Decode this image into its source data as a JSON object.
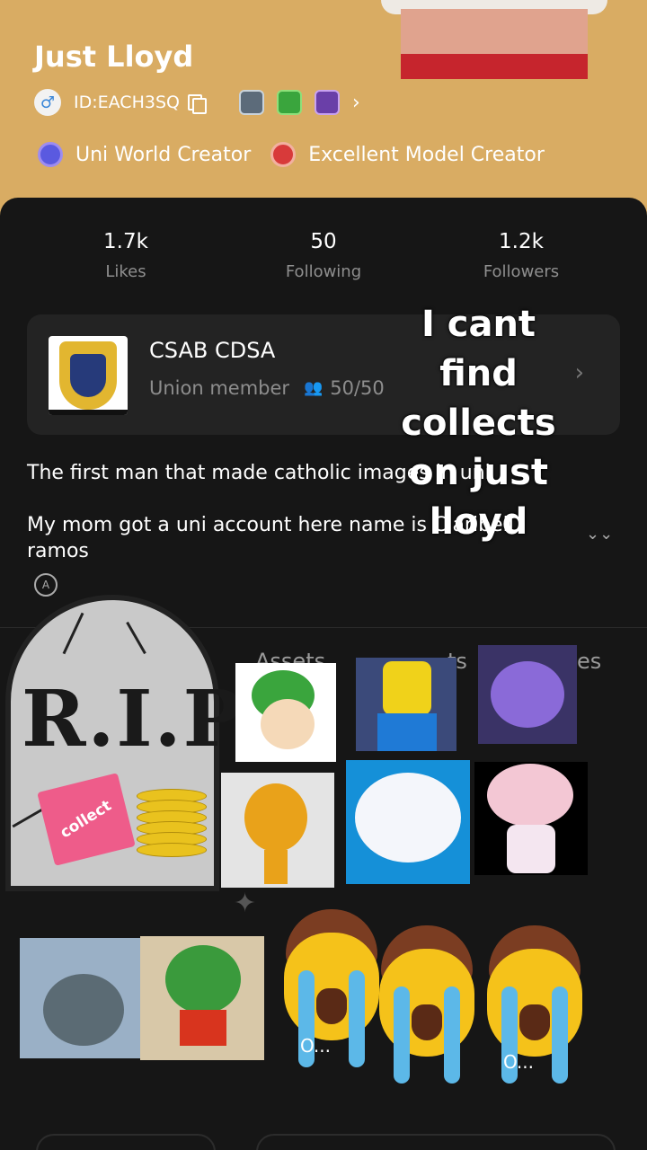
{
  "profile": {
    "name": "Just Lloyd",
    "gender_symbol": "♂",
    "id": "ID:EACH3SQ",
    "more_symbol": "›",
    "titles": [
      "Uni World Creator",
      "Excellent Model Creator"
    ]
  },
  "stats": [
    {
      "value": "1.7k",
      "label": "Likes"
    },
    {
      "value": "50",
      "label": "Following"
    },
    {
      "value": "1.2k",
      "label": "Followers"
    }
  ],
  "union": {
    "name": "CSAB CDSA",
    "role": "Union member",
    "people_symbol": "👥",
    "members": "50/50",
    "chevron": "›"
  },
  "overlay_caption": "I cant find collects on just lloyd",
  "bio": {
    "line1": "The first man that made catholic images in uni",
    "line2": "My mom got a uni account here name is Claribell ramos",
    "expand_symbol": "⌄⌄",
    "badge_letter": "A"
  },
  "tabs": {
    "assets": "Assets",
    "collects_partial": "ts",
    "likes_partial": "es"
  },
  "stickers": {
    "rip_text": "R.I.P",
    "collect_label": "collect",
    "crying_dots": "O..."
  },
  "colors": {
    "header_bg": "#d9ac63",
    "card_bg": "#161616",
    "union_bg": "#232323",
    "muted_text": "#8f8f8f"
  }
}
